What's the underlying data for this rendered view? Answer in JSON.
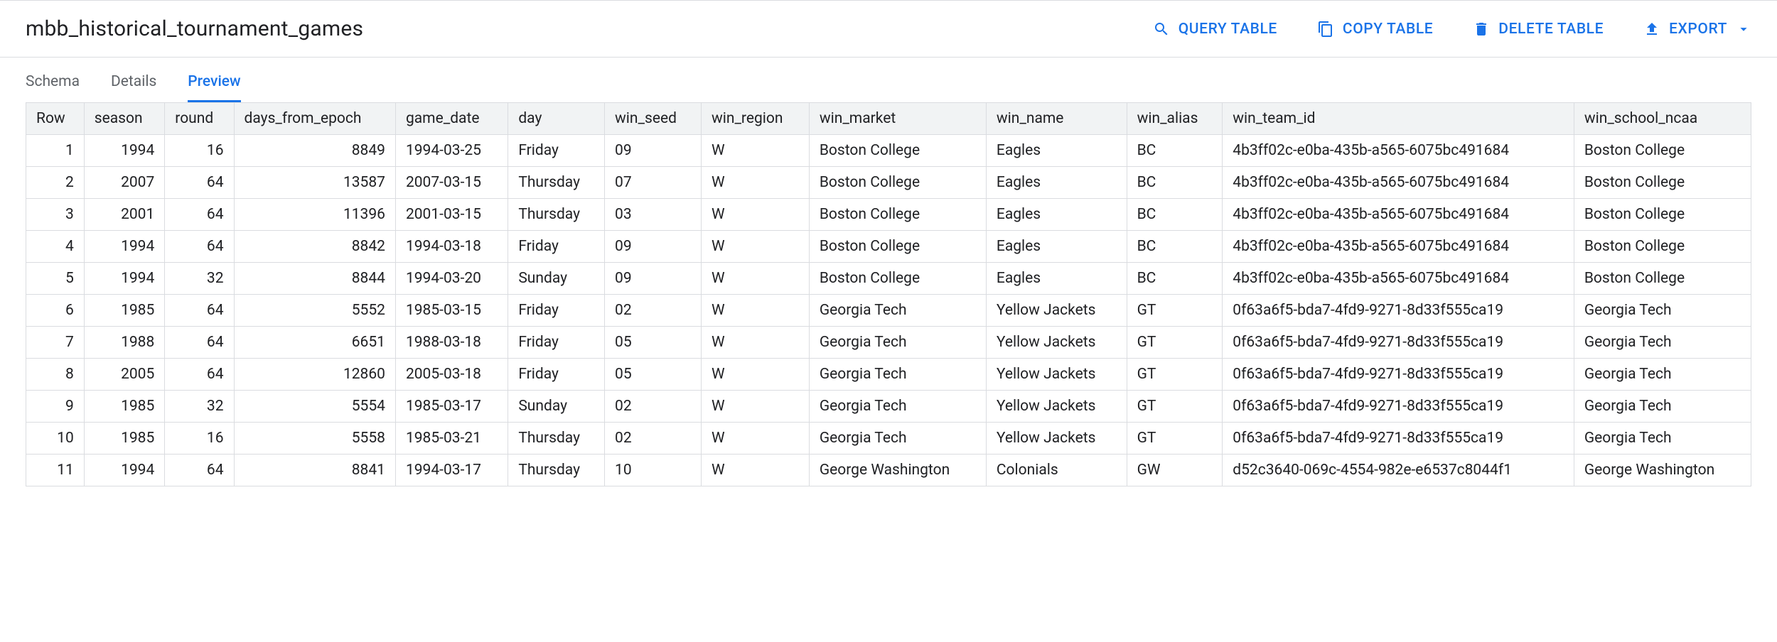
{
  "header": {
    "title": "mbb_historical_tournament_games",
    "actions": {
      "query": "QUERY TABLE",
      "copy": "COPY TABLE",
      "delete": "DELETE TABLE",
      "export": "EXPORT"
    }
  },
  "tabs": {
    "schema": "Schema",
    "details": "Details",
    "preview": "Preview"
  },
  "table": {
    "columns": [
      "Row",
      "season",
      "round",
      "days_from_epoch",
      "game_date",
      "day",
      "win_seed",
      "win_region",
      "win_market",
      "win_name",
      "win_alias",
      "win_team_id",
      "win_school_ncaa"
    ],
    "rows": [
      {
        "row": "1",
        "season": "1994",
        "round": "16",
        "days_from_epoch": "8849",
        "game_date": "1994-03-25",
        "day": "Friday",
        "win_seed": "09",
        "win_region": "W",
        "win_market": "Boston College",
        "win_name": "Eagles",
        "win_alias": "BC",
        "win_team_id": "4b3ff02c-e0ba-435b-a565-6075bc491684",
        "win_school_ncaa": "Boston College"
      },
      {
        "row": "2",
        "season": "2007",
        "round": "64",
        "days_from_epoch": "13587",
        "game_date": "2007-03-15",
        "day": "Thursday",
        "win_seed": "07",
        "win_region": "W",
        "win_market": "Boston College",
        "win_name": "Eagles",
        "win_alias": "BC",
        "win_team_id": "4b3ff02c-e0ba-435b-a565-6075bc491684",
        "win_school_ncaa": "Boston College"
      },
      {
        "row": "3",
        "season": "2001",
        "round": "64",
        "days_from_epoch": "11396",
        "game_date": "2001-03-15",
        "day": "Thursday",
        "win_seed": "03",
        "win_region": "W",
        "win_market": "Boston College",
        "win_name": "Eagles",
        "win_alias": "BC",
        "win_team_id": "4b3ff02c-e0ba-435b-a565-6075bc491684",
        "win_school_ncaa": "Boston College"
      },
      {
        "row": "4",
        "season": "1994",
        "round": "64",
        "days_from_epoch": "8842",
        "game_date": "1994-03-18",
        "day": "Friday",
        "win_seed": "09",
        "win_region": "W",
        "win_market": "Boston College",
        "win_name": "Eagles",
        "win_alias": "BC",
        "win_team_id": "4b3ff02c-e0ba-435b-a565-6075bc491684",
        "win_school_ncaa": "Boston College"
      },
      {
        "row": "5",
        "season": "1994",
        "round": "32",
        "days_from_epoch": "8844",
        "game_date": "1994-03-20",
        "day": "Sunday",
        "win_seed": "09",
        "win_region": "W",
        "win_market": "Boston College",
        "win_name": "Eagles",
        "win_alias": "BC",
        "win_team_id": "4b3ff02c-e0ba-435b-a565-6075bc491684",
        "win_school_ncaa": "Boston College"
      },
      {
        "row": "6",
        "season": "1985",
        "round": "64",
        "days_from_epoch": "5552",
        "game_date": "1985-03-15",
        "day": "Friday",
        "win_seed": "02",
        "win_region": "W",
        "win_market": "Georgia Tech",
        "win_name": "Yellow Jackets",
        "win_alias": "GT",
        "win_team_id": "0f63a6f5-bda7-4fd9-9271-8d33f555ca19",
        "win_school_ncaa": "Georgia Tech"
      },
      {
        "row": "7",
        "season": "1988",
        "round": "64",
        "days_from_epoch": "6651",
        "game_date": "1988-03-18",
        "day": "Friday",
        "win_seed": "05",
        "win_region": "W",
        "win_market": "Georgia Tech",
        "win_name": "Yellow Jackets",
        "win_alias": "GT",
        "win_team_id": "0f63a6f5-bda7-4fd9-9271-8d33f555ca19",
        "win_school_ncaa": "Georgia Tech"
      },
      {
        "row": "8",
        "season": "2005",
        "round": "64",
        "days_from_epoch": "12860",
        "game_date": "2005-03-18",
        "day": "Friday",
        "win_seed": "05",
        "win_region": "W",
        "win_market": "Georgia Tech",
        "win_name": "Yellow Jackets",
        "win_alias": "GT",
        "win_team_id": "0f63a6f5-bda7-4fd9-9271-8d33f555ca19",
        "win_school_ncaa": "Georgia Tech"
      },
      {
        "row": "9",
        "season": "1985",
        "round": "32",
        "days_from_epoch": "5554",
        "game_date": "1985-03-17",
        "day": "Sunday",
        "win_seed": "02",
        "win_region": "W",
        "win_market": "Georgia Tech",
        "win_name": "Yellow Jackets",
        "win_alias": "GT",
        "win_team_id": "0f63a6f5-bda7-4fd9-9271-8d33f555ca19",
        "win_school_ncaa": "Georgia Tech"
      },
      {
        "row": "10",
        "season": "1985",
        "round": "16",
        "days_from_epoch": "5558",
        "game_date": "1985-03-21",
        "day": "Thursday",
        "win_seed": "02",
        "win_region": "W",
        "win_market": "Georgia Tech",
        "win_name": "Yellow Jackets",
        "win_alias": "GT",
        "win_team_id": "0f63a6f5-bda7-4fd9-9271-8d33f555ca19",
        "win_school_ncaa": "Georgia Tech"
      },
      {
        "row": "11",
        "season": "1994",
        "round": "64",
        "days_from_epoch": "8841",
        "game_date": "1994-03-17",
        "day": "Thursday",
        "win_seed": "10",
        "win_region": "W",
        "win_market": "George Washington",
        "win_name": "Colonials",
        "win_alias": "GW",
        "win_team_id": "d52c3640-069c-4554-982e-e6537c8044f1",
        "win_school_ncaa": "George Washington"
      }
    ]
  }
}
